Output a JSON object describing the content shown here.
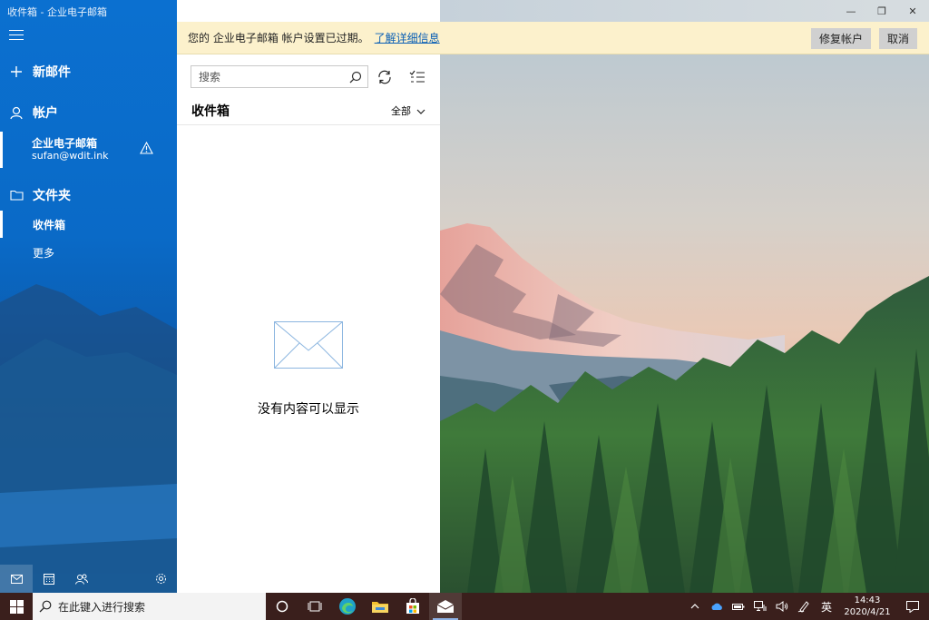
{
  "window": {
    "title": "收件箱 - 企业电子邮箱",
    "minimize_glyph": "—",
    "restore_glyph": "❐",
    "close_glyph": "✕"
  },
  "sidebar": {
    "new_mail": "新邮件",
    "accounts_header": "帐户",
    "account": {
      "name": "企业电子邮箱",
      "email": "sufan@wdit.ink"
    },
    "folders_header": "文件夹",
    "folders": [
      {
        "label": "收件箱",
        "selected": true
      },
      {
        "label": "更多",
        "selected": false
      }
    ],
    "bottom_icons": [
      "mail-icon",
      "calendar-icon",
      "people-icon",
      "settings-icon"
    ],
    "accent": "#0b6fd0"
  },
  "notice": {
    "message": "您的 企业电子邮箱 帐户设置已过期。",
    "link": "了解详细信息",
    "fix_button": "修复帐户",
    "cancel_button": "取消"
  },
  "message_list": {
    "search_placeholder": "搜索",
    "title": "收件箱",
    "filter": "全部",
    "empty_text": "没有内容可以显示"
  },
  "taskbar": {
    "search_placeholder": "在此键入进行搜索",
    "ime": "英",
    "time": "14:43",
    "date": "2020/4/21",
    "bg": "#3a1f1c"
  }
}
